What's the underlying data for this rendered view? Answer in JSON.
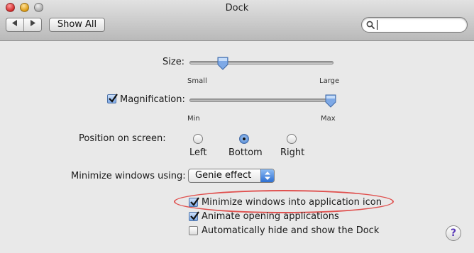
{
  "window": {
    "title": "Dock"
  },
  "toolbar": {
    "back_icon": "triangle-left",
    "forward_icon": "triangle-right",
    "show_all_label": "Show All",
    "search": {
      "value": "",
      "placeholder": ""
    }
  },
  "size": {
    "label": "Size:",
    "min_label": "Small",
    "max_label": "Large",
    "value": 0.23
  },
  "magnification": {
    "label": "Magnification:",
    "checked": true,
    "min_label": "Min",
    "max_label": "Max",
    "value": 0.98
  },
  "position": {
    "label": "Position on screen:",
    "options": [
      {
        "label": "Left",
        "selected": false
      },
      {
        "label": "Bottom",
        "selected": true
      },
      {
        "label": "Right",
        "selected": false
      }
    ]
  },
  "minimize": {
    "label": "Minimize windows using:",
    "selected": "Genie effect"
  },
  "checkboxes": [
    {
      "label": "Minimize windows into application icon",
      "checked": true
    },
    {
      "label": "Animate opening applications",
      "checked": true
    },
    {
      "label": "Automatically hide and show the Dock",
      "checked": false
    }
  ],
  "help": {
    "label": "?"
  },
  "colors": {
    "accent_blue": "#4c86d3",
    "annotation_red": "#e0514f",
    "help_purple": "#5b3ab8"
  }
}
